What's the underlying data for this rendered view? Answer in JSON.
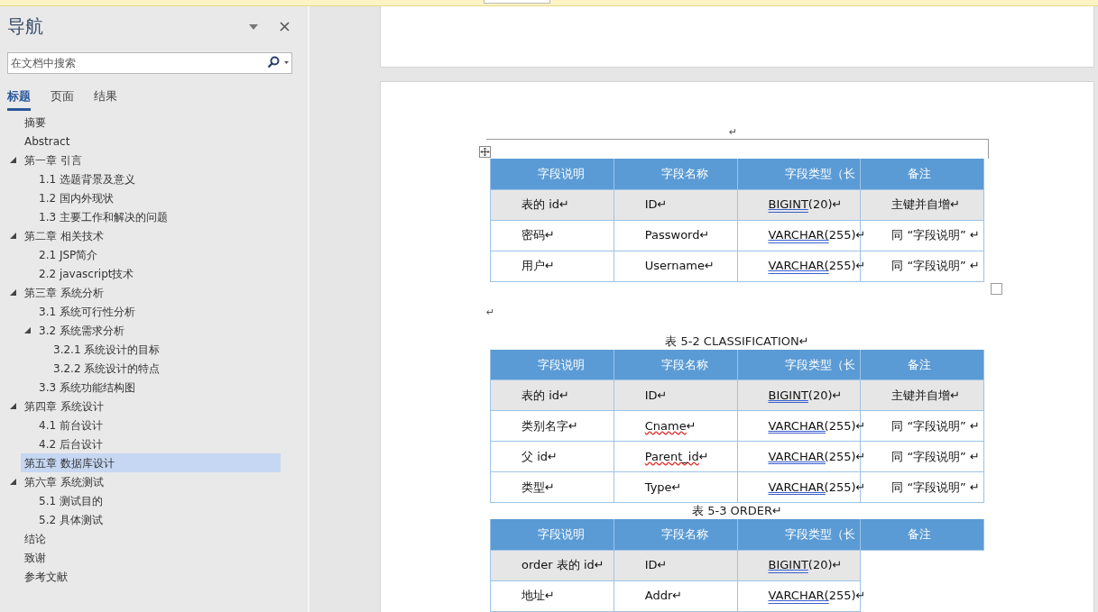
{
  "navigation": {
    "title": "导航",
    "search": {
      "placeholder": "在文档中搜索"
    },
    "tabs": [
      {
        "label": "标题",
        "selected": true
      },
      {
        "label": "页面",
        "selected": false
      },
      {
        "label": "结果",
        "selected": false
      }
    ],
    "headings": [
      {
        "label": "摘要",
        "selected": false
      },
      {
        "label": "Abstract",
        "selected": false
      },
      {
        "label": "第一章 引言",
        "selected": false,
        "expanded": true,
        "children": [
          {
            "label": "1.1 选题背景及意义",
            "selected": false
          },
          {
            "label": "1.2 国内外现状",
            "selected": false
          },
          {
            "label": "1.3 主要工作和解决的问题",
            "selected": false
          }
        ]
      },
      {
        "label": "第二章 相关技术",
        "selected": false,
        "expanded": true,
        "children": [
          {
            "label": "2.1 JSP简介",
            "selected": false
          },
          {
            "label": "2.2 javascript技术",
            "selected": false
          }
        ]
      },
      {
        "label": "第三章 系统分析",
        "selected": false,
        "expanded": true,
        "children": [
          {
            "label": "3.1 系统可行性分析",
            "selected": false
          },
          {
            "label": "3.2 系统需求分析",
            "selected": false,
            "expanded": true,
            "children": [
              {
                "label": "3.2.1 系统设计的目标",
                "selected": false
              },
              {
                "label": "3.2.2 系统设计的特点",
                "selected": false
              }
            ]
          },
          {
            "label": "3.3 系统功能结构图",
            "selected": false
          }
        ]
      },
      {
        "label": "第四章 系统设计",
        "selected": false,
        "expanded": true,
        "children": [
          {
            "label": "4.1 前台设计",
            "selected": false
          },
          {
            "label": "4.2 后台设计",
            "selected": false
          }
        ]
      },
      {
        "label": "第五章 数据库设计",
        "selected": true
      },
      {
        "label": "第六章 系统测试",
        "selected": false,
        "expanded": true,
        "children": [
          {
            "label": "5.1 测试目的",
            "selected": false
          },
          {
            "label": "5.2 具体测试",
            "selected": false
          }
        ]
      },
      {
        "label": "结论",
        "selected": false
      },
      {
        "label": "致谢",
        "selected": false
      },
      {
        "label": "参考文献",
        "selected": false
      }
    ]
  },
  "document": {
    "blocks": [
      {
        "kind": "mark",
        "text": "↵"
      },
      {
        "kind": "table",
        "frame": true,
        "columns": [
          "字段说明",
          "字段名称",
          "字段类型（长",
          "备注"
        ],
        "rows": [
          [
            {
              "text": "表的 id↵"
            },
            {
              "text": "ID↵"
            },
            {
              "flagged": "BIGINT",
              "rest": "(20)↵",
              "grammar_error": true
            },
            {
              "text": "主键并自增↵"
            }
          ],
          [
            {
              "text": "密码↵"
            },
            {
              "text": "Password↵"
            },
            {
              "flagged": "VARCHAR(",
              "rest": "255)↵",
              "grammar_error": true
            },
            {
              "text": "同 “字段说明” ↵"
            }
          ],
          [
            {
              "text": "用户↵"
            },
            {
              "text": "Username↵"
            },
            {
              "flagged": "VARCHAR(",
              "rest": "255)↵",
              "grammar_error": true
            },
            {
              "text": "同 “字段说明” ↵"
            }
          ]
        ]
      },
      {
        "kind": "mark",
        "text": "↵"
      },
      {
        "kind": "caption",
        "text": "表  5-2 CLASSIFICATION↵"
      },
      {
        "kind": "table",
        "frame": false,
        "columns": [
          "字段说明",
          "字段名称",
          "字段类型（长",
          "备注"
        ],
        "rows": [
          [
            {
              "text": "表的 id↵"
            },
            {
              "text": "ID↵"
            },
            {
              "flagged": "BIGINT",
              "rest": "(20)↵",
              "grammar_error": true
            },
            {
              "text": "主键并自增↵"
            }
          ],
          [
            {
              "text": "类别名字↵"
            },
            {
              "flagged": "Cname",
              "rest": "↵",
              "spelling_error": true
            },
            {
              "flagged": "VARCHAR(",
              "rest": "255)↵",
              "grammar_error": true
            },
            {
              "text": "同 “字段说明” ↵"
            }
          ],
          [
            {
              "text": "父 id↵"
            },
            {
              "flagged": "Parent_id",
              "rest": "↵",
              "spelling_error": true
            },
            {
              "flagged": "VARCHAR(",
              "rest": "255)↵",
              "grammar_error": true
            },
            {
              "text": "同 “字段说明” ↵"
            }
          ],
          [
            {
              "text": "类型↵"
            },
            {
              "text": "Type↵"
            },
            {
              "flagged": "VARCHAR(",
              "rest": "255)↵",
              "grammar_error": true
            },
            {
              "text": "同 “字段说明” ↵"
            }
          ]
        ]
      },
      {
        "kind": "caption",
        "text": "表  5-3 ORDER↵"
      },
      {
        "kind": "table",
        "frame": false,
        "columns": [
          "字段说明",
          "字段名称",
          "字段类型（长",
          "备注"
        ],
        "rows": [
          [
            {
              "text": "order 表的 id↵"
            },
            {
              "text": "ID↵"
            },
            {
              "flagged": "BIGINT",
              "rest": "(20)↵",
              "grammar_error": true
            }
          ],
          [
            {
              "text": "地址↵"
            },
            {
              "text": "Addr↵"
            },
            {
              "flagged": "VARCHAR(",
              "rest": "255)↵",
              "grammar_error": true
            }
          ]
        ]
      }
    ]
  }
}
